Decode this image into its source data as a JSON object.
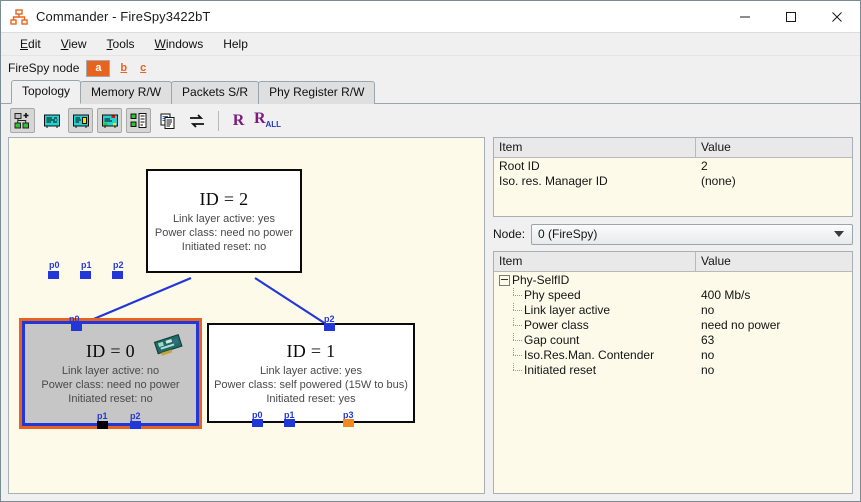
{
  "window": {
    "title": "Commander - FireSpy3422bT",
    "app_icon": "topology-tree-icon",
    "minimize_label": "minimize-icon",
    "maximize_label": "maximize-icon",
    "close_label": "close-icon"
  },
  "menubar": {
    "items": [
      {
        "label": "Edit",
        "mnemonic": "E"
      },
      {
        "label": "View",
        "mnemonic": "V"
      },
      {
        "label": "Tools",
        "mnemonic": "T"
      },
      {
        "label": "Windows",
        "mnemonic": "W"
      },
      {
        "label": "Help",
        "mnemonic": ""
      }
    ]
  },
  "node_selector": {
    "label": "FireSpy node",
    "selected": "a",
    "options": [
      "a",
      "b",
      "c"
    ],
    "selected_color": "#e8641e",
    "link_color": "#e8641e"
  },
  "tabs": {
    "active": "Topology",
    "items": [
      {
        "label": "Topology"
      },
      {
        "label": "Memory R/W"
      },
      {
        "label": "Packets S/R"
      },
      {
        "label": "Phy Register R/W"
      }
    ]
  },
  "toolbar": {
    "buttons": [
      {
        "name": "topology-add-icon",
        "framed": true
      },
      {
        "name": "node-list-icon",
        "framed": false
      },
      {
        "name": "node-detail-icon",
        "framed": true
      },
      {
        "name": "node-status-icon",
        "framed": true
      },
      {
        "name": "tree-view-icon",
        "framed": true
      },
      {
        "name": "copy-icon",
        "framed": false
      },
      {
        "name": "refresh-icon",
        "framed": false
      }
    ],
    "reset_label": "R",
    "reset_all_label": "R",
    "reset_all_sub": "ALL",
    "reset_color": "#7b1a7b",
    "reset_all_sub_color": "#2236c0"
  },
  "topology": {
    "background": "#fdfaea",
    "nodes": [
      {
        "id": "ID = 2",
        "selected": false,
        "lines": [
          "Link layer active: yes",
          "Power class: need no power",
          "Initiated reset: no"
        ],
        "ports": [
          {
            "label": "p0",
            "color": "blue"
          },
          {
            "label": "p1",
            "color": "blue"
          },
          {
            "label": "p2",
            "color": "blue"
          }
        ]
      },
      {
        "id": "ID = 0",
        "selected": true,
        "has_card_icon": true,
        "lines": [
          "Link layer active: no",
          "Power class: need no power",
          "Initiated reset: no"
        ],
        "ports": [
          {
            "label": "p0",
            "color": "blue"
          },
          {
            "label": "p1",
            "color": "black"
          },
          {
            "label": "p2",
            "color": "blue"
          }
        ]
      },
      {
        "id": "ID = 1",
        "selected": false,
        "lines": [
          "Link layer active: yes",
          "Power class: self powered (15W to bus)",
          "Initiated reset: yes"
        ],
        "ports": [
          {
            "label": "p2",
            "color": "blue"
          },
          {
            "label": "p0",
            "color": "blue"
          },
          {
            "label": "p1",
            "color": "blue"
          },
          {
            "label": "p3",
            "color": "orange"
          }
        ]
      }
    ],
    "link_color": "#2237d8",
    "selected_outline_color": "#e8641e",
    "selected_border_color": "#2237d8"
  },
  "bus_info": {
    "columns": [
      "Item",
      "Value"
    ],
    "rows": [
      {
        "item": "Root ID",
        "value": "2"
      },
      {
        "item": "Iso. res. Manager ID",
        "value": "(none)"
      }
    ]
  },
  "node_combo": {
    "label": "Node:",
    "value": "0 (FireSpy)",
    "arrow": "chevron-down-icon"
  },
  "selfid_info": {
    "columns": [
      "Item",
      "Value"
    ],
    "root": {
      "label": "Phy-SelfID",
      "expanded": true
    },
    "rows": [
      {
        "item": "Phy speed",
        "value": "400 Mb/s"
      },
      {
        "item": "Link layer active",
        "value": "no"
      },
      {
        "item": "Power class",
        "value": "need no power"
      },
      {
        "item": "Gap count",
        "value": "63"
      },
      {
        "item": "Iso.Res.Man. Contender",
        "value": "no"
      },
      {
        "item": "Initiated reset",
        "value": "no"
      }
    ]
  }
}
